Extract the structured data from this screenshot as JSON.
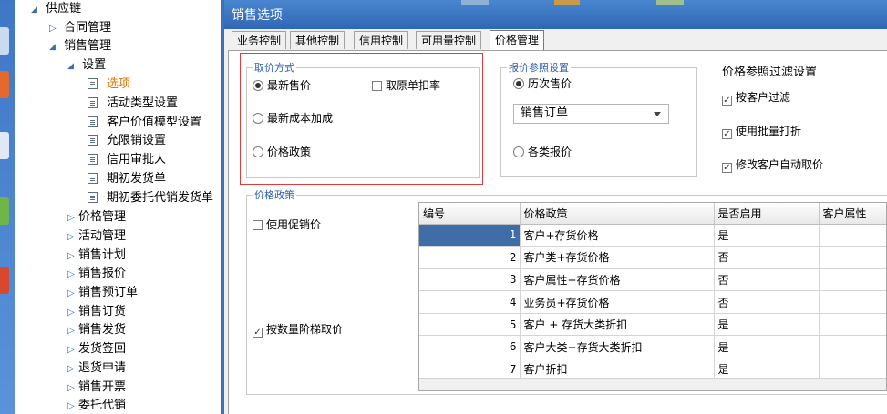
{
  "tree": {
    "root": "供应链",
    "contract": "合同管理",
    "sales_mgmt": "销售管理",
    "settings": "设置",
    "settings_items": [
      "选项",
      "活动类型设置",
      "客户价值模型设置",
      "允限销设置",
      "信用审批人",
      "期初发货单",
      "期初委托代销发货单"
    ],
    "sales_items": [
      "价格管理",
      "活动管理",
      "销售计划",
      "销售报价",
      "销售预订单",
      "销售订货",
      "销售发货",
      "发货签回",
      "退货申请",
      "销售开票",
      "委托代销"
    ]
  },
  "dialog": {
    "title": "销售选项",
    "tabs": [
      "业务控制",
      "其他控制",
      "信用控制",
      "可用量控制",
      "价格管理"
    ],
    "active_tab": "价格管理"
  },
  "pricing_method": {
    "legend": "取价方式",
    "options": [
      "最新售价",
      "最新成本加成",
      "价格政策"
    ],
    "selected": "最新售价",
    "original_discount": {
      "label": "取原单扣率",
      "checked": false
    }
  },
  "price_reference": {
    "legend": "报价参照设置",
    "options": [
      "历次售价",
      "各类报价"
    ],
    "selected": "历次售价",
    "source_value": "销售订单"
  },
  "price_filter": {
    "title": "价格参照过滤设置",
    "checks": [
      {
        "label": "按客户过滤",
        "checked": true
      },
      {
        "label": "使用批量打折",
        "checked": true
      },
      {
        "label": "修改客户自动取价",
        "checked": true
      }
    ]
  },
  "policy": {
    "legend": "价格政策",
    "use_promo": {
      "label": "使用促销价",
      "checked": false
    },
    "tiered": {
      "label": "按数量阶梯取价",
      "checked": true
    },
    "columns": [
      "编号",
      "价格政策",
      "是否启用",
      "客户属性"
    ],
    "rows": [
      {
        "no": "1",
        "policy": "客户+存货价格",
        "enabled": "是",
        "attr": ""
      },
      {
        "no": "2",
        "policy": "客户类+存货价格",
        "enabled": "否",
        "attr": ""
      },
      {
        "no": "3",
        "policy": "客户属性+存货价格",
        "enabled": "否",
        "attr": ""
      },
      {
        "no": "4",
        "policy": "业务员+存货价格",
        "enabled": "否",
        "attr": ""
      },
      {
        "no": "5",
        "policy": "客户 + 存货大类折扣",
        "enabled": "是",
        "attr": ""
      },
      {
        "no": "6",
        "policy": "客户大类+存货大类折扣",
        "enabled": "是",
        "attr": ""
      },
      {
        "no": "7",
        "policy": "客户折扣",
        "enabled": "是",
        "attr": ""
      }
    ],
    "selected_row": "1"
  },
  "colors": {
    "titlebar": "#2f67b4",
    "selected_node": "#e07000",
    "grid_selection": "#3f6da8",
    "highlight_outline": "#e23b3b"
  }
}
